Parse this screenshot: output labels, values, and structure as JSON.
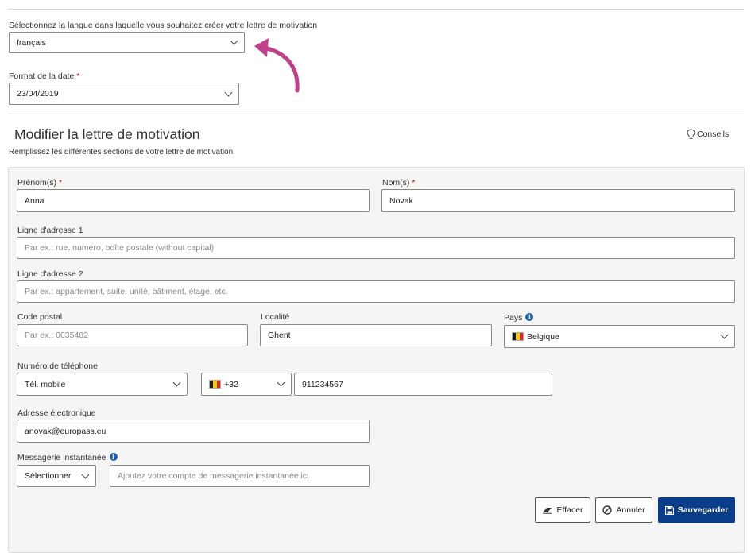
{
  "language": {
    "label": "Sélectionnez la langue dans laquelle vous souhaitez créer votre lettre de motivation",
    "value": "français"
  },
  "date_format": {
    "label": "Format de la date",
    "required_mark": "*",
    "value": "23/04/2019"
  },
  "section": {
    "title": "Modifier la lettre de motivation",
    "subtitle": "Remplissez les différentes sections de votre lettre de motivation",
    "tips_label": "Conseils"
  },
  "form": {
    "first_name": {
      "label": "Prénom(s)",
      "required_mark": "*",
      "value": "Anna"
    },
    "last_name": {
      "label": "Nom(s)",
      "required_mark": "*",
      "value": "Novak"
    },
    "address1": {
      "label": "Ligne d'adresse 1",
      "placeholder": "Par ex.: rue, numéro, boîte postale (without capital)"
    },
    "address2": {
      "label": "Ligne d'adresse 2",
      "placeholder": "Par ex.: appartement, suite, unité, bâtiment, étage, etc."
    },
    "postal_code": {
      "label": "Code postal",
      "placeholder": "Par ex.: 0035482"
    },
    "city": {
      "label": "Localité",
      "value": "Ghent"
    },
    "country": {
      "label": "Pays",
      "value": "Belgique"
    },
    "phone": {
      "label": "Numéro de téléphone",
      "type_value": "Tél. mobile",
      "prefix_value": "+32",
      "number_value": "911234567"
    },
    "email": {
      "label": "Adresse électronique",
      "value": "anovak@europass.eu"
    },
    "im": {
      "label": "Messagerie instantanée",
      "select_value": "Sélectionner",
      "placeholder": "Ajoutez votre compte de messagerie instantanée ici"
    }
  },
  "actions": {
    "clear": "Effacer",
    "cancel": "Annuler",
    "save": "Sauvegarder"
  },
  "colors": {
    "accent": "#0a3e8a",
    "annotation_arrow": "#c0418a",
    "required": "#d0021b",
    "info": "#1b5fae"
  },
  "icons": {
    "tips": "lightbulb-icon",
    "clear": "eraser-icon",
    "cancel": "ban-icon",
    "save": "floppy-disk-icon",
    "info": "info-icon",
    "flag": "belgium-flag-icon",
    "annotation": "curved-arrow-icon"
  }
}
